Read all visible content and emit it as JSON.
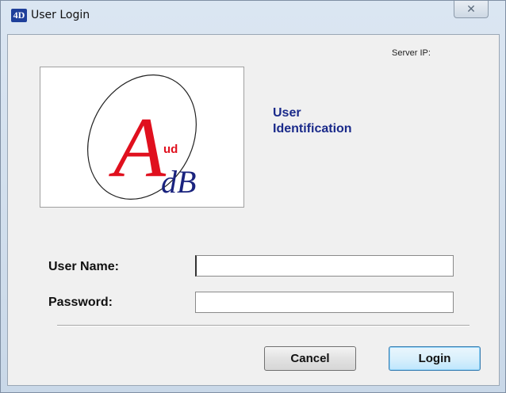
{
  "window": {
    "title": "User Login",
    "app_icon_text": "4D",
    "close_glyph": "✕"
  },
  "server": {
    "label": "Server IP:"
  },
  "logo": {
    "big_letter": "A",
    "small_text": "ud",
    "suffix_text": "dB",
    "colors": {
      "letter": "#e0101e",
      "suffix": "#1a237e",
      "ring": "#222222"
    }
  },
  "heading": {
    "line1": "User",
    "line2": "Identification",
    "color": "#1a2a8a"
  },
  "form": {
    "username_label": "User Name:",
    "username_value": "",
    "password_label": "Password:",
    "password_value": ""
  },
  "buttons": {
    "cancel_label": "Cancel",
    "login_label": "Login"
  },
  "icons": {
    "app": "4d-app-icon",
    "close": "close-icon"
  }
}
